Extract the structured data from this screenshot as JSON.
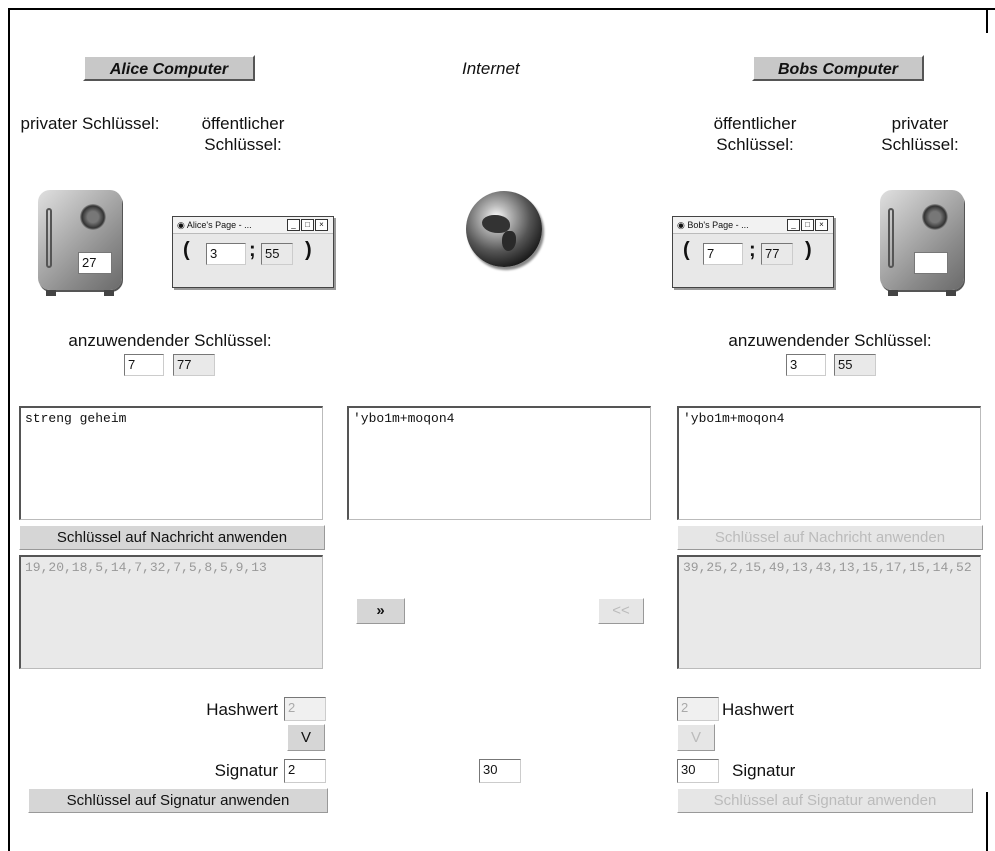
{
  "header": {
    "alice_button": "Alice Computer",
    "internet_title": "Internet",
    "bob_button": "Bobs Computer"
  },
  "alice": {
    "private_label": "privater Schlüssel:",
    "public_label": "öffentlicher Schlüssel:",
    "safe_value": "27",
    "window_title": "Alice's Page - ...",
    "public_key_a": "3",
    "public_key_b": "55",
    "apply_label": "anzuwendender Schlüssel:",
    "apply_key_a": "7",
    "apply_key_b": "77",
    "message": "streng geheim",
    "apply_msg_button": "Schlüssel auf Nachricht anwenden",
    "numbers": "19,20,18,5,14,7,32,7,5,8,5,9,13",
    "hash_label": "Hashwert",
    "hash_value": "2",
    "hash_button": "V",
    "signature_label": "Signatur",
    "signature_value": "2",
    "apply_sig_button": "Schlüssel auf Signatur anwenden"
  },
  "internet": {
    "message": "'ybo1m+moqon4",
    "send_right": "»",
    "send_left": "<<",
    "signature_value": "30"
  },
  "bob": {
    "public_label": "öffentlicher Schlüssel:",
    "private_label": "privater Schlüssel:",
    "safe_value": "",
    "window_title": "Bob's Page - ...",
    "public_key_a": "7",
    "public_key_b": "77",
    "apply_label": "anzuwendender Schlüssel:",
    "apply_key_a": "3",
    "apply_key_b": "55",
    "message": "'ybo1m+moqon4",
    "apply_msg_button": "Schlüssel auf Nachricht anwenden",
    "numbers": "39,25,2,15,49,13,43,13,15,17,15,14,52",
    "hash_label": "Hashwert",
    "hash_value": "2",
    "hash_button": "V",
    "signature_label": "Signatur",
    "signature_value": "30",
    "apply_sig_button": "Schlüssel auf Signatur anwenden"
  }
}
